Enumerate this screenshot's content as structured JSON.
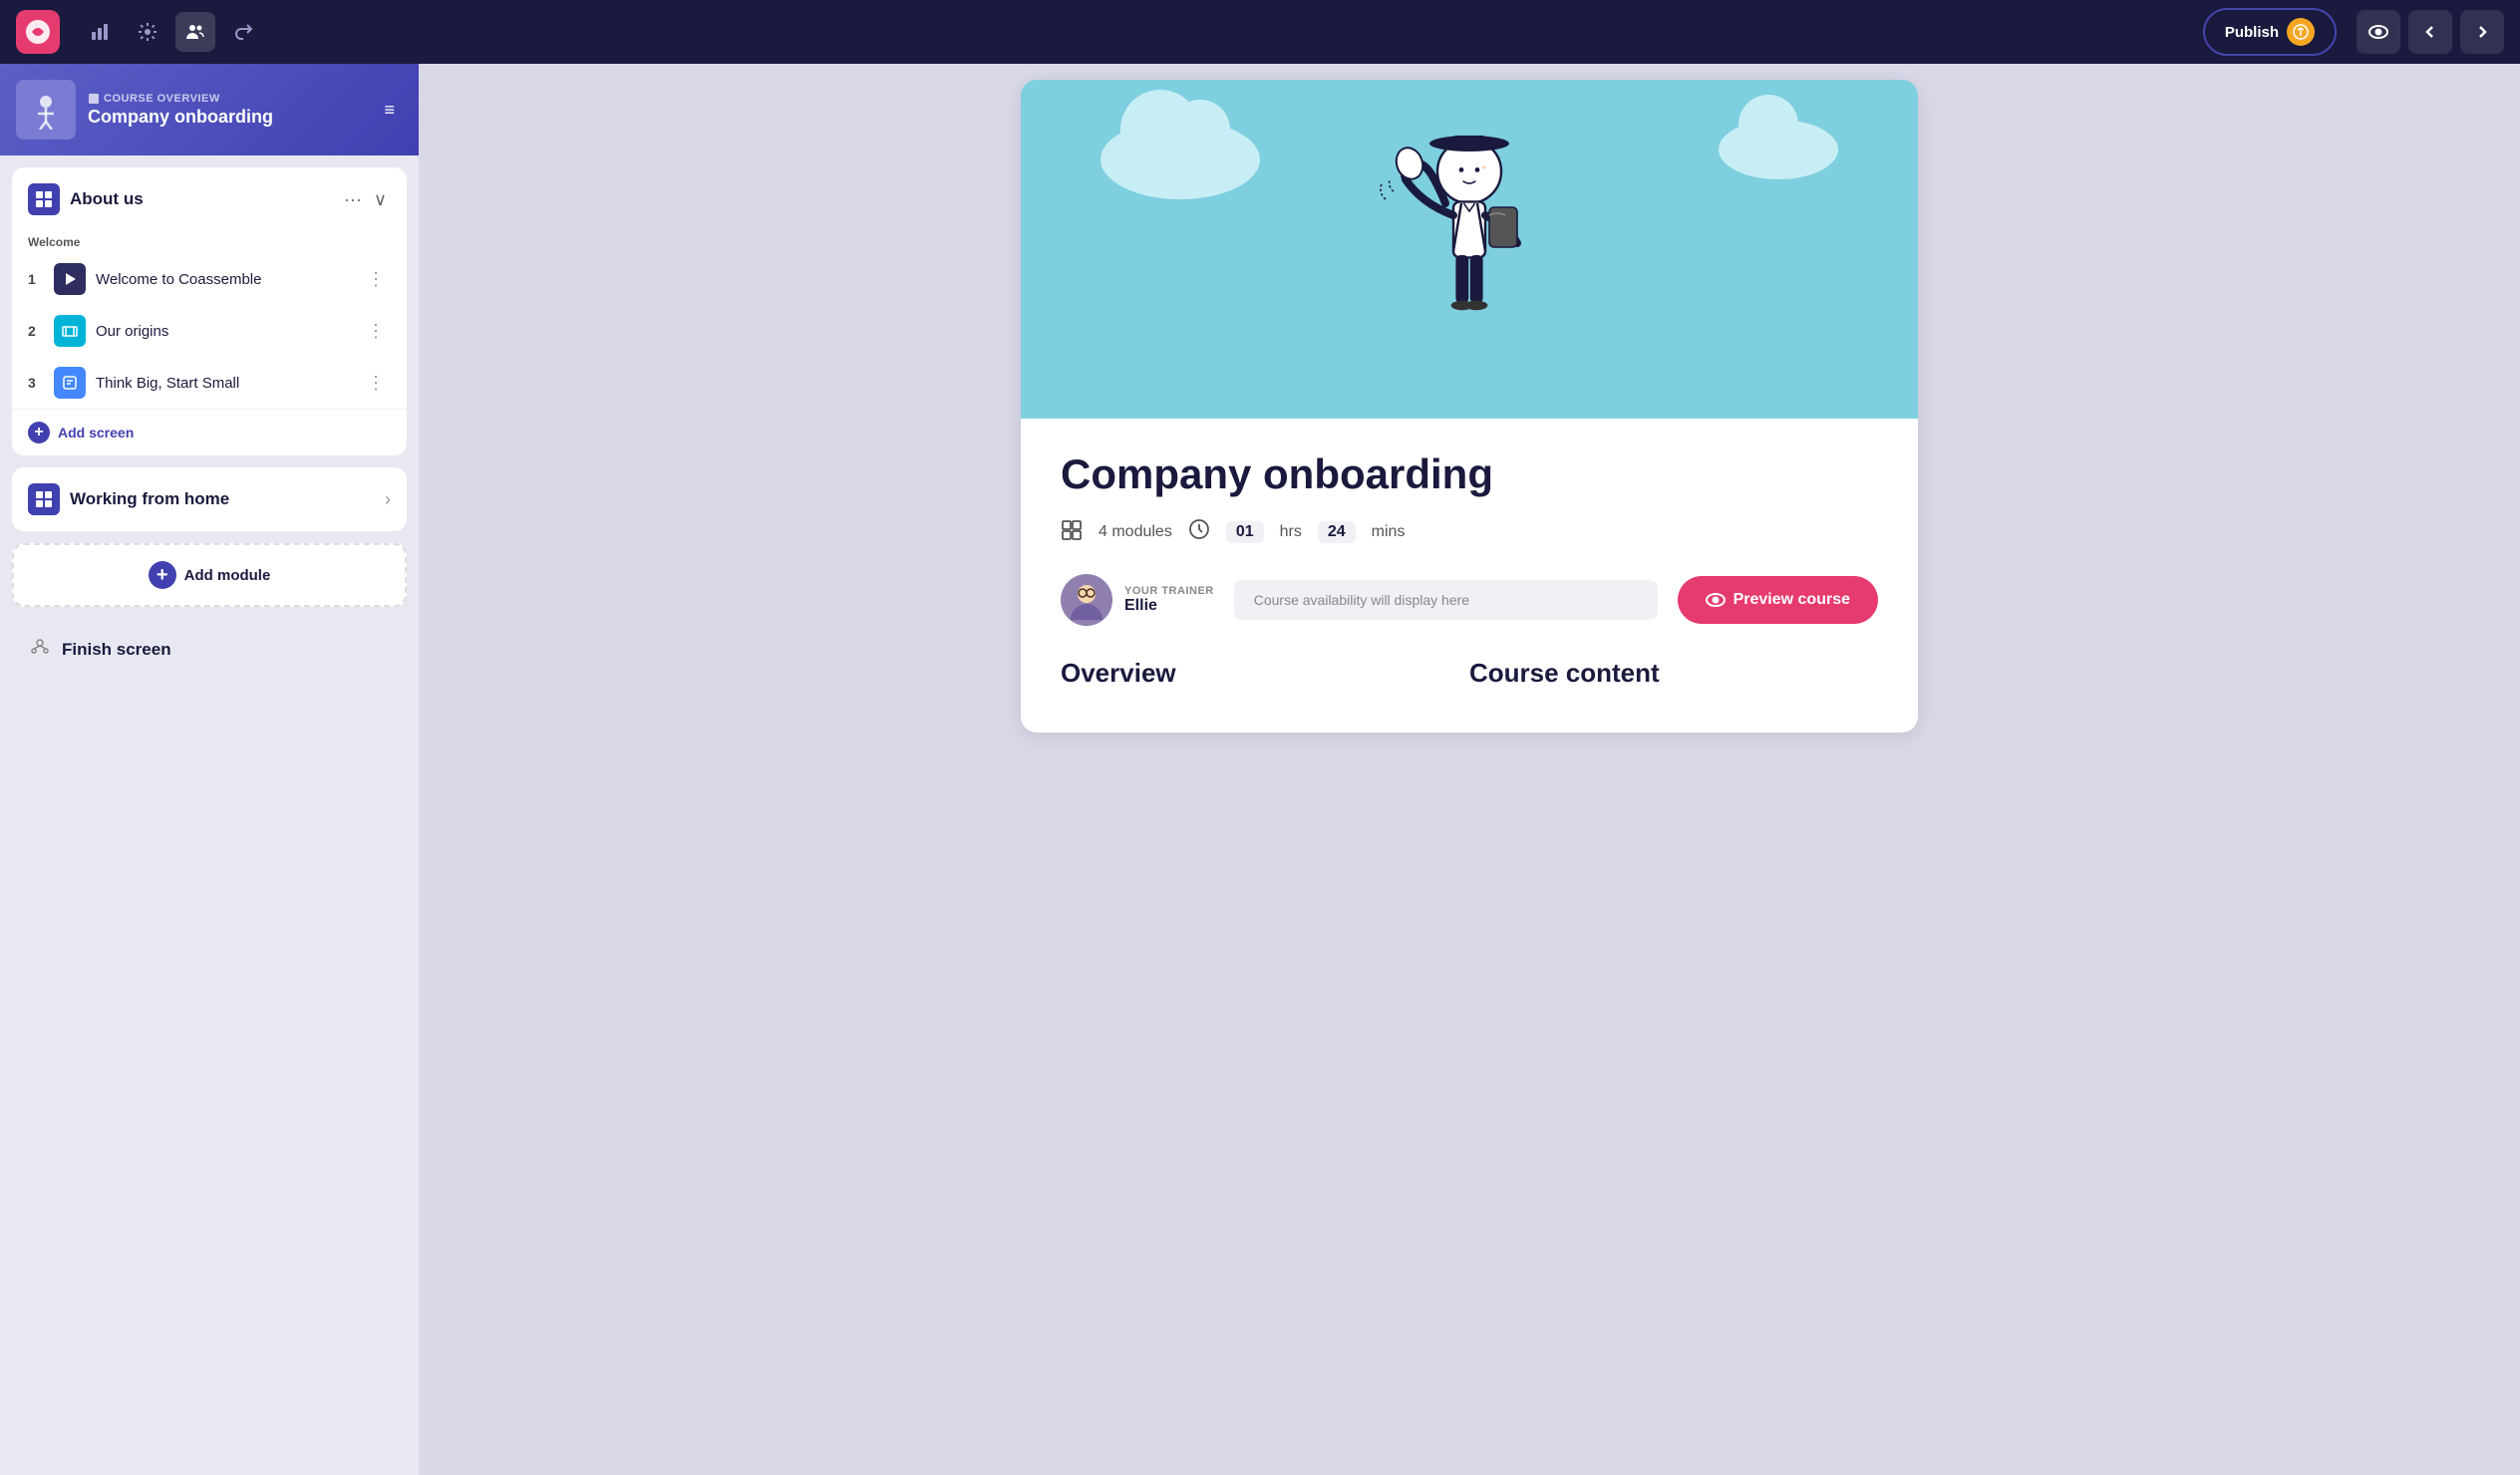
{
  "topNav": {
    "publishLabel": "Publish",
    "icons": {
      "analytics": "📊",
      "settings": "⚙️",
      "team": "👥",
      "share": "↗️",
      "preview": "👁",
      "back": "←",
      "forward": "→"
    }
  },
  "courseHeader": {
    "overviewLabel": "COURSE OVERVIEW",
    "courseTitle": "Company onboarding"
  },
  "modules": [
    {
      "id": "about-us",
      "title": "About us",
      "expanded": true,
      "sections": [
        {
          "label": "Welcome",
          "screens": [
            {
              "num": "1",
              "name": "Welcome to Coassemble",
              "iconStyle": "dark",
              "icon": "▶"
            },
            {
              "num": "2",
              "name": "Our origins",
              "iconStyle": "teal",
              "icon": "🎞"
            },
            {
              "num": "3",
              "name": "Think Big, Start Small",
              "iconStyle": "blue",
              "icon": "📋"
            }
          ]
        }
      ],
      "addScreenLabel": "Add screen"
    },
    {
      "id": "working-from-home",
      "title": "Working from home",
      "expanded": false
    }
  ],
  "addModuleLabel": "Add module",
  "finishScreenLabel": "Finish screen",
  "preview": {
    "courseTitle": "Company onboarding",
    "modules": "4 modules",
    "duration": {
      "hrs": "01",
      "hrsLabel": "hrs",
      "mins": "24",
      "minsLabel": "mins"
    },
    "trainer": {
      "label": "YOUR TRAINER",
      "name": "Ellie"
    },
    "availabilityPlaceholder": "Course availability will display here",
    "previewCourseLabel": "Preview course",
    "overviewTitle": "Overview",
    "courseContentTitle": "Course content"
  }
}
